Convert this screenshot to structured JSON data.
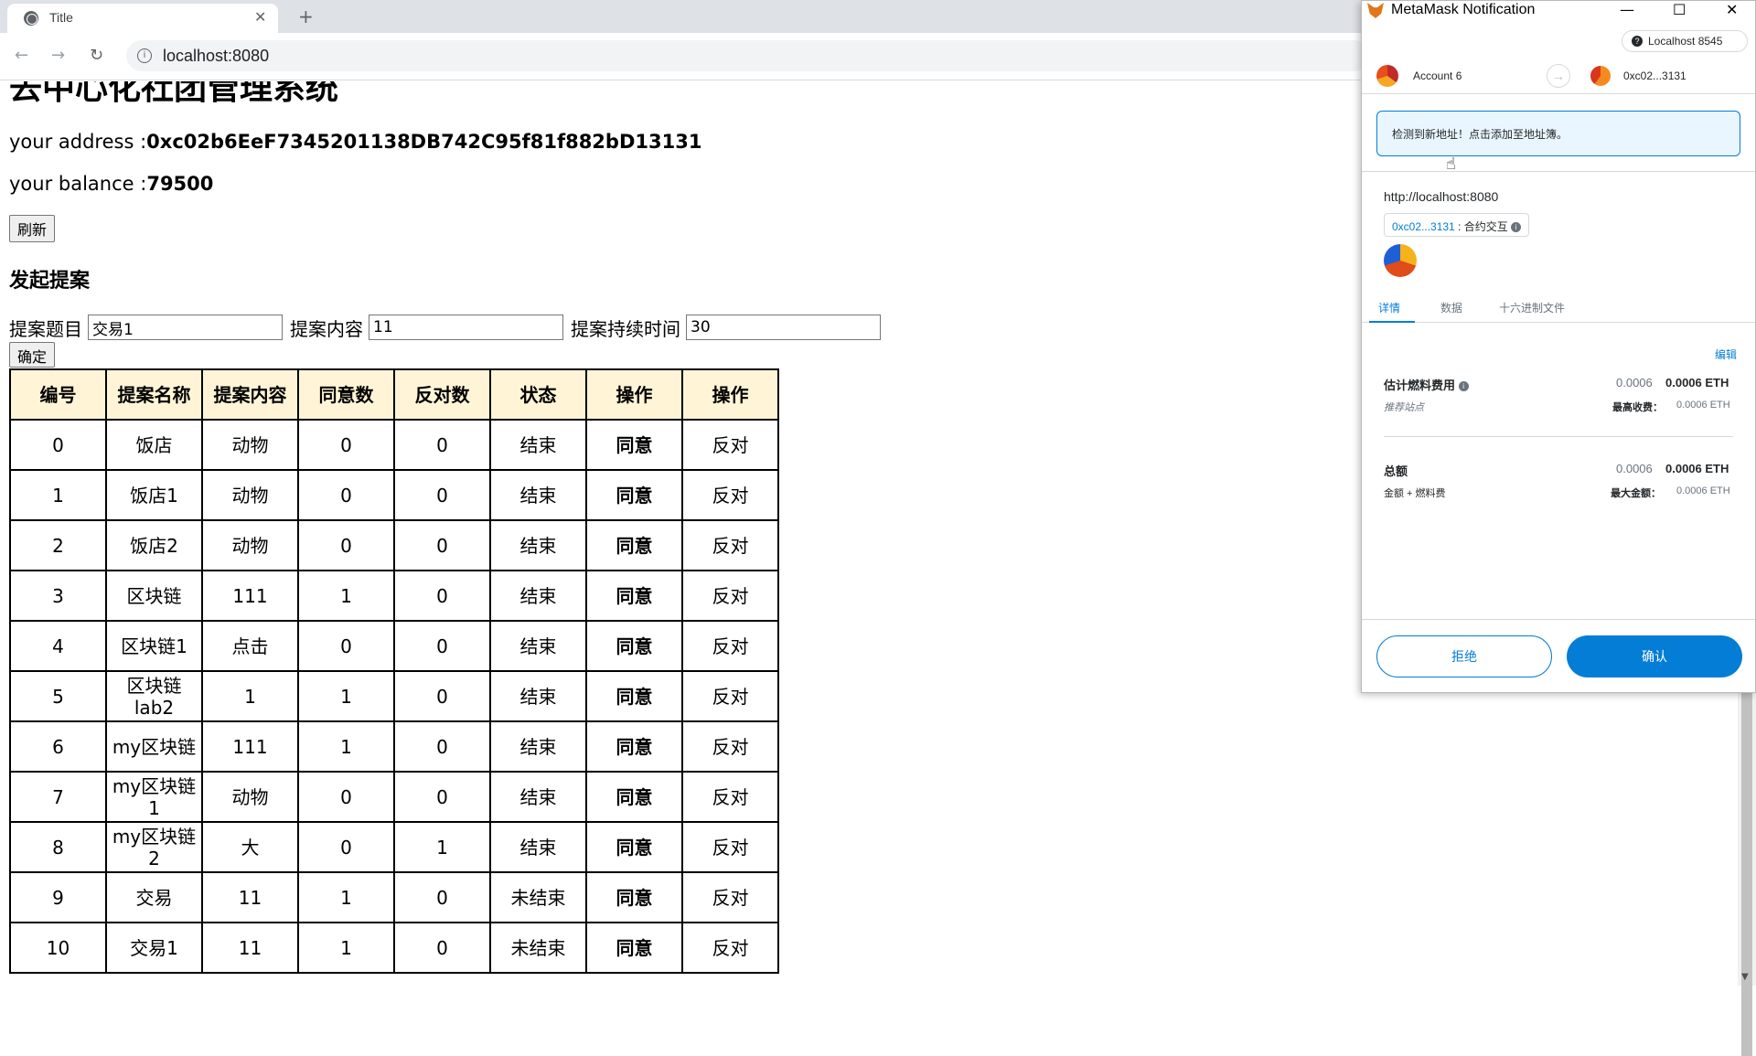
{
  "browser": {
    "tab_title": "Title",
    "url": "localhost:8080"
  },
  "page": {
    "title": "去中心化社团管理系统",
    "address_label": "your address :",
    "address_value": "0xc02b6EeF7345201138DB742C95f81f882bD13131",
    "balance_label": "your balance :",
    "balance_value": "79500",
    "refresh_label": "刷新",
    "section_title": "发起提案",
    "form": {
      "title_label": "提案题目",
      "title_value": "交易1",
      "content_label": "提案内容",
      "content_value": "11",
      "duration_label": "提案持续时间",
      "duration_value": "30",
      "confirm_label": "确定"
    },
    "table": {
      "headers": [
        "编号",
        "提案名称",
        "提案内容",
        "同意数",
        "反对数",
        "状态",
        "操作",
        "操作"
      ],
      "rows": [
        [
          "0",
          "饭店",
          "动物",
          "0",
          "0",
          "结束",
          "同意",
          "反对"
        ],
        [
          "1",
          "饭店1",
          "动物",
          "0",
          "0",
          "结束",
          "同意",
          "反对"
        ],
        [
          "2",
          "饭店2",
          "动物",
          "0",
          "0",
          "结束",
          "同意",
          "反对"
        ],
        [
          "3",
          "区块链",
          "111",
          "1",
          "0",
          "结束",
          "同意",
          "反对"
        ],
        [
          "4",
          "区块链1",
          "点击",
          "0",
          "0",
          "结束",
          "同意",
          "反对"
        ],
        [
          "5",
          "区块链lab2",
          "1",
          "1",
          "0",
          "结束",
          "同意",
          "反对"
        ],
        [
          "6",
          "my区块链",
          "111",
          "1",
          "0",
          "结束",
          "同意",
          "反对"
        ],
        [
          "7",
          "my区块链1",
          "动物",
          "0",
          "0",
          "结束",
          "同意",
          "反对"
        ],
        [
          "8",
          "my区块链2",
          "大",
          "0",
          "1",
          "结束",
          "同意",
          "反对"
        ],
        [
          "9",
          "交易",
          "11",
          "1",
          "0",
          "未结束",
          "同意",
          "反对"
        ],
        [
          "10",
          "交易1",
          "11",
          "1",
          "0",
          "未结束",
          "同意",
          "反对"
        ]
      ]
    }
  },
  "metamask": {
    "window_title": "MetaMask Notification",
    "network": "Localhost 8545",
    "from_account": "Account 6",
    "to_address": "0xc02...3131",
    "notice": "检测到新地址！点击添加至地址簿。",
    "origin": "http://localhost:8080",
    "contract_link": "0xc02...3131",
    "contract_action": " : 合约交互",
    "tabs": [
      "详情",
      "数据",
      "十六进制文件"
    ],
    "edit_label": "编辑",
    "fee_label": "估计燃料费用",
    "fee_sub": "推荐站点",
    "fee_value_grey": "0.0006",
    "fee_value_bold": "0.0006 ETH",
    "max_fee_label": "最高收费：",
    "max_fee_value": "0.0006 ETH",
    "total_label": "总额",
    "total_sub": "金额 + 燃料费",
    "total_value_grey": "0.0006",
    "total_value_bold": "0.0006 ETH",
    "max_amount_label": "最大金额：",
    "max_amount_value": "0.0006 ETH",
    "reject_label": "拒绝",
    "confirm_label": "确认"
  }
}
